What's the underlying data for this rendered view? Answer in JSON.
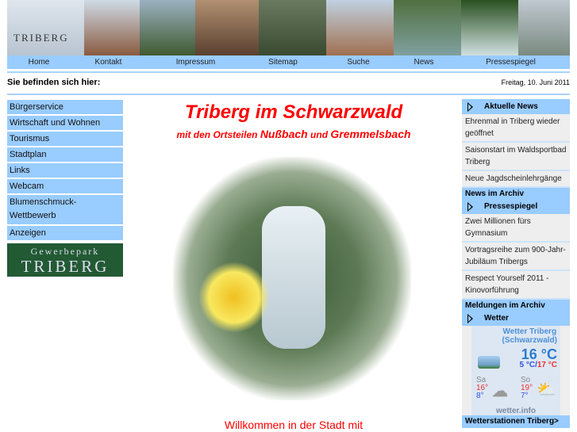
{
  "header": {
    "logo": "TRIBERG"
  },
  "nav": [
    "Home",
    "Kontakt",
    "Impressum",
    "Sitemap",
    "Suche",
    "News",
    "Pressespiegel"
  ],
  "breadcrumb": "Sie befinden sich hier:",
  "date": "Freitag, 10. Juni 2011",
  "menu": [
    "Bürgerservice",
    "Wirtschaft und Wohnen",
    "Tourismus",
    "Stadtplan",
    "Links",
    "Webcam",
    "Blumenschmuck-Wettbewerb",
    "Anzeigen"
  ],
  "gewerbepark": {
    "line1": "Gewerbepark",
    "line2": "TRIBERG"
  },
  "main": {
    "title": "Triberg im Schwarzwald",
    "sub_prefix": "mit den Ortsteilen",
    "link1": "Nußbach",
    "und": "und",
    "link2": "Gremmelsbach",
    "welcome": "Willkommen in der Stadt mit"
  },
  "news": {
    "title": "Aktuelle News",
    "items": [
      "Ehrenmal in Triberg wieder geöffnet",
      "Saisonstart im Waldsportbad Triberg",
      "Neue Jagdscheinlehrgänge"
    ],
    "footer": "News im Archiv"
  },
  "presse": {
    "title": "Pressespiegel",
    "items": [
      "Zwei Millionen fürs Gymnasium",
      "Vortragsreihe zum 900-Jahr-Jubiläum Tribergs",
      "Respect Yourself 2011 - Kinovorführung"
    ],
    "footer": "Meldungen im Archiv"
  },
  "wetter": {
    "title": "Wetter",
    "place": "Wetter Triberg",
    "region": "(Schwarzwald)",
    "temp": "16 °C",
    "min": "5 °C",
    "sep": "/",
    "max": "17 °C",
    "days": [
      {
        "d": "Sa",
        "hi": "16°",
        "lo": "8°"
      },
      {
        "d": "So",
        "hi": "19°",
        "lo": "7°"
      }
    ],
    "brand": "wetter.info",
    "footer": "Wetterstationen Triberg>"
  }
}
